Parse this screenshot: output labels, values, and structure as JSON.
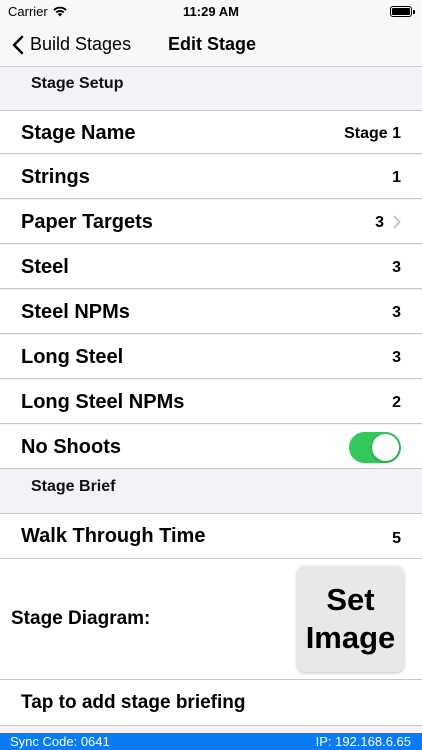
{
  "status_bar": {
    "carrier": "Carrier",
    "time": "11:29 AM"
  },
  "nav": {
    "back_label": "Build Stages",
    "title": "Edit Stage"
  },
  "sections": {
    "setup": "Stage Setup",
    "brief": "Stage Brief"
  },
  "rows": {
    "stage_name": {
      "label": "Stage Name",
      "value": "Stage 1"
    },
    "strings": {
      "label": "Strings",
      "value": "1"
    },
    "paper_targets": {
      "label": "Paper Targets",
      "value": "3"
    },
    "steel": {
      "label": "Steel",
      "value": "3"
    },
    "steel_npms": {
      "label": "Steel NPMs",
      "value": "3"
    },
    "long_steel": {
      "label": "Long Steel",
      "value": "3"
    },
    "long_steel_npms": {
      "label": "Long Steel NPMs",
      "value": "2"
    },
    "no_shoots": {
      "label": "No Shoots"
    },
    "walk_through": {
      "label": "Walk Through Time",
      "value": "5"
    }
  },
  "diagram": {
    "label": "Stage Diagram:",
    "button_line1": "Set",
    "button_line2": "Image"
  },
  "briefing": {
    "label": "Tap to add stage briefing"
  },
  "footer": {
    "sync": "Sync Code: 0641",
    "ip": "IP: 192.168.6.65"
  },
  "colors": {
    "toggle_on": "#34c759",
    "footer_bg": "#0a7bf2"
  }
}
